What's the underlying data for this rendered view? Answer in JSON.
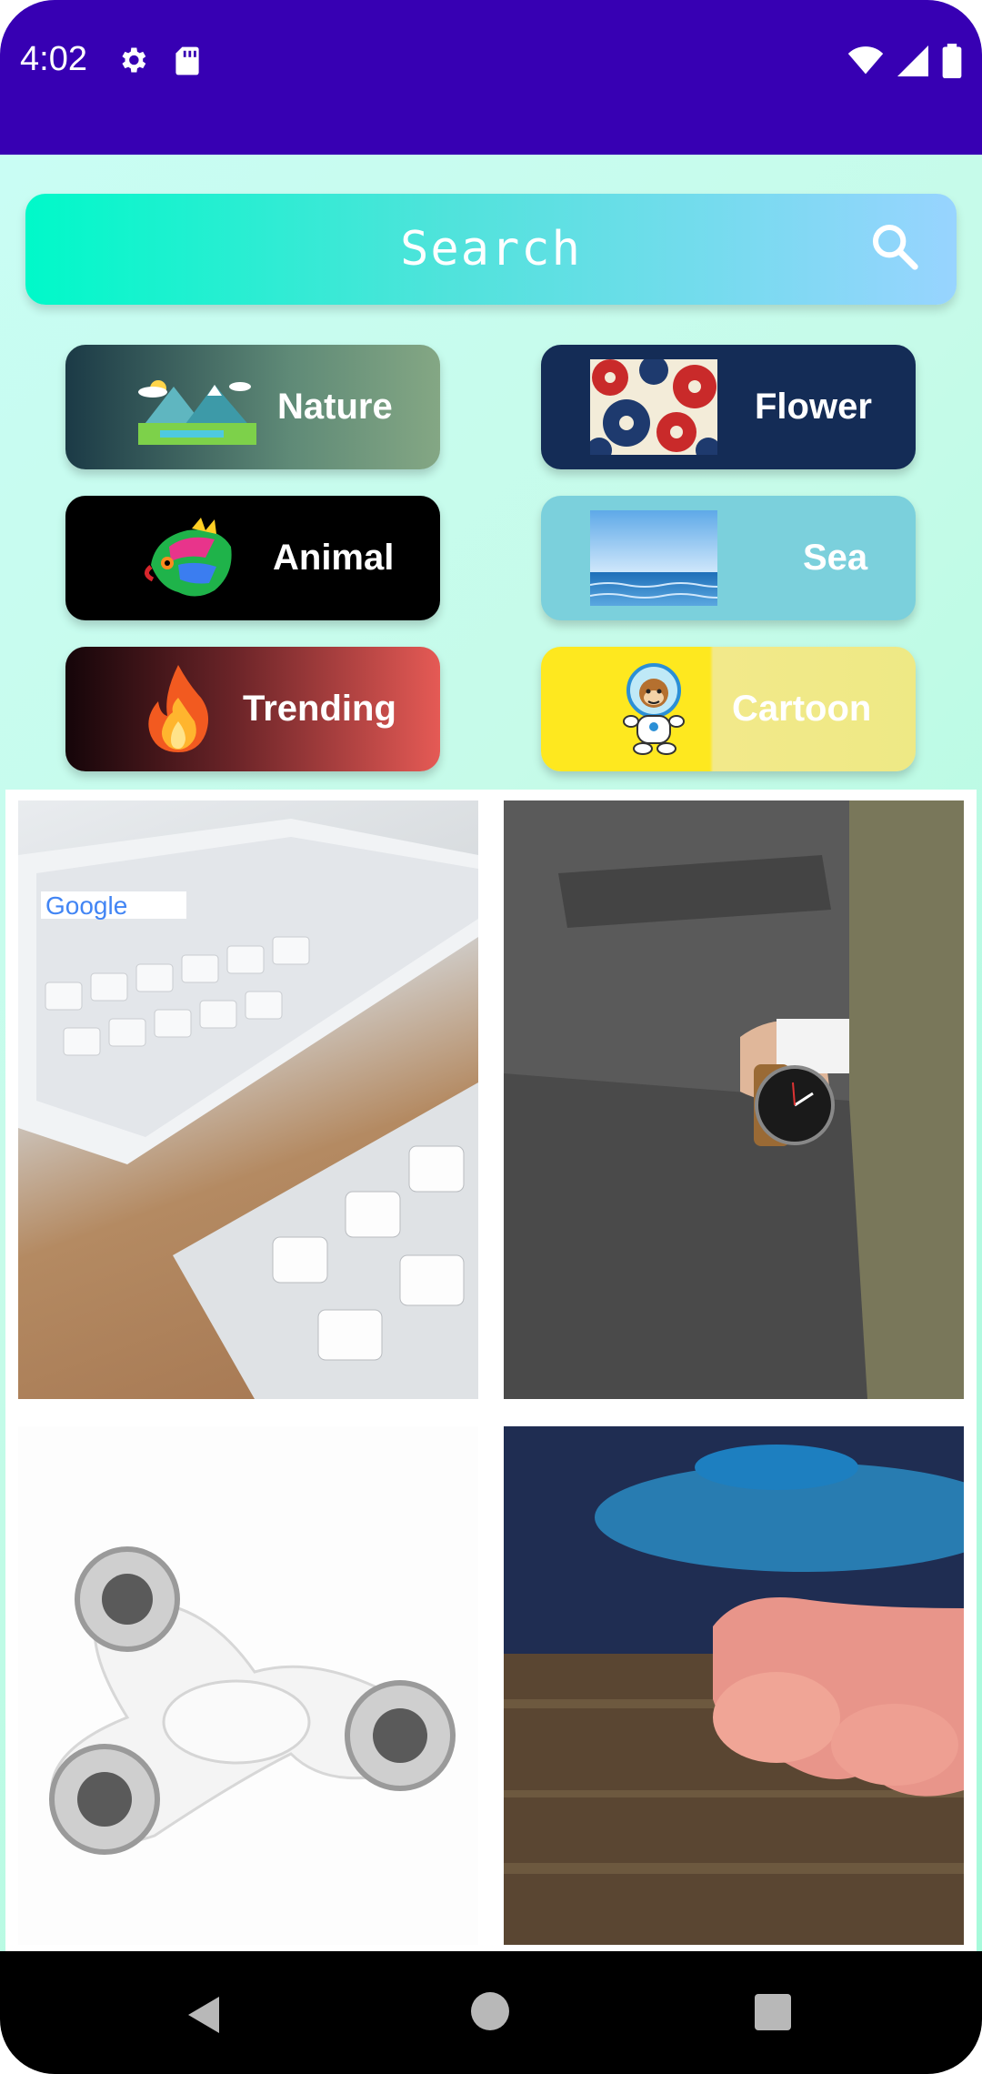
{
  "status_bar": {
    "time": "4:02",
    "icons": [
      "gear-icon",
      "sd-card-icon",
      "wifi-icon",
      "signal-icon",
      "battery-icon"
    ]
  },
  "search": {
    "label": "Search",
    "icon": "search-icon"
  },
  "categories": [
    {
      "label": "Nature",
      "icon": "landscape-icon"
    },
    {
      "label": "Flower",
      "icon": "flower-pattern-icon"
    },
    {
      "label": "Animal",
      "icon": "iguana-icon"
    },
    {
      "label": "Sea",
      "icon": "sea-horizon-icon"
    },
    {
      "label": "Trending",
      "icon": "fire-icon"
    },
    {
      "label": "Cartoon",
      "icon": "monkey-astronaut-icon"
    }
  ],
  "gallery": {
    "images": [
      "keyboard-tablet-photo",
      "suit-watch-photo",
      "fidget-spinner-white-photo",
      "fidget-spinner-blue-photo"
    ]
  },
  "nav_bar": {
    "buttons": [
      "back-icon",
      "home-icon",
      "recent-apps-icon"
    ]
  }
}
